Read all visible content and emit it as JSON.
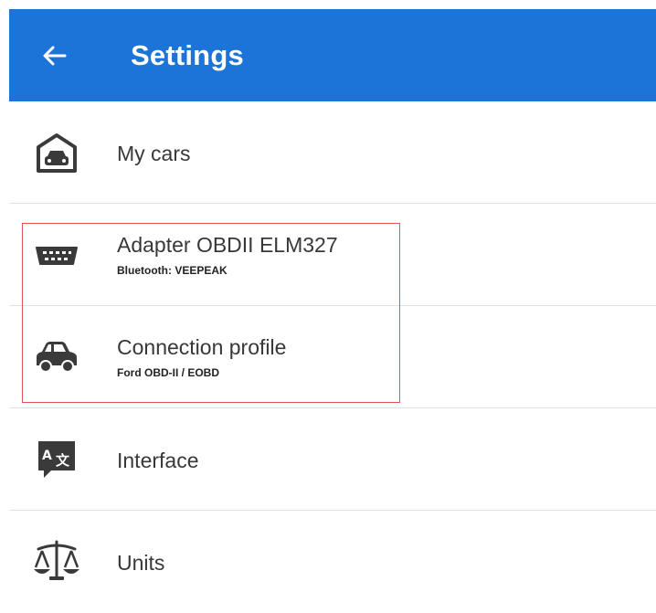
{
  "appbar": {
    "title": "Settings",
    "back_icon": "arrow-left-icon",
    "background_color": "#1c74d9"
  },
  "settings": {
    "items": [
      {
        "label": "My cars",
        "subtitle": "",
        "icon": "garage-car-icon"
      },
      {
        "label": "Adapter OBDII ELM327",
        "subtitle": "Bluetooth: VEEPEAK",
        "icon": "obd-connector-icon"
      },
      {
        "label": "Connection profile",
        "subtitle": "Ford OBD-II / EOBD",
        "icon": "car-icon"
      },
      {
        "label": "Interface",
        "subtitle": "",
        "icon": "translate-icon"
      },
      {
        "label": "Units",
        "subtitle": "",
        "icon": "scale-icon"
      }
    ]
  },
  "highlight_color": "#e05555"
}
